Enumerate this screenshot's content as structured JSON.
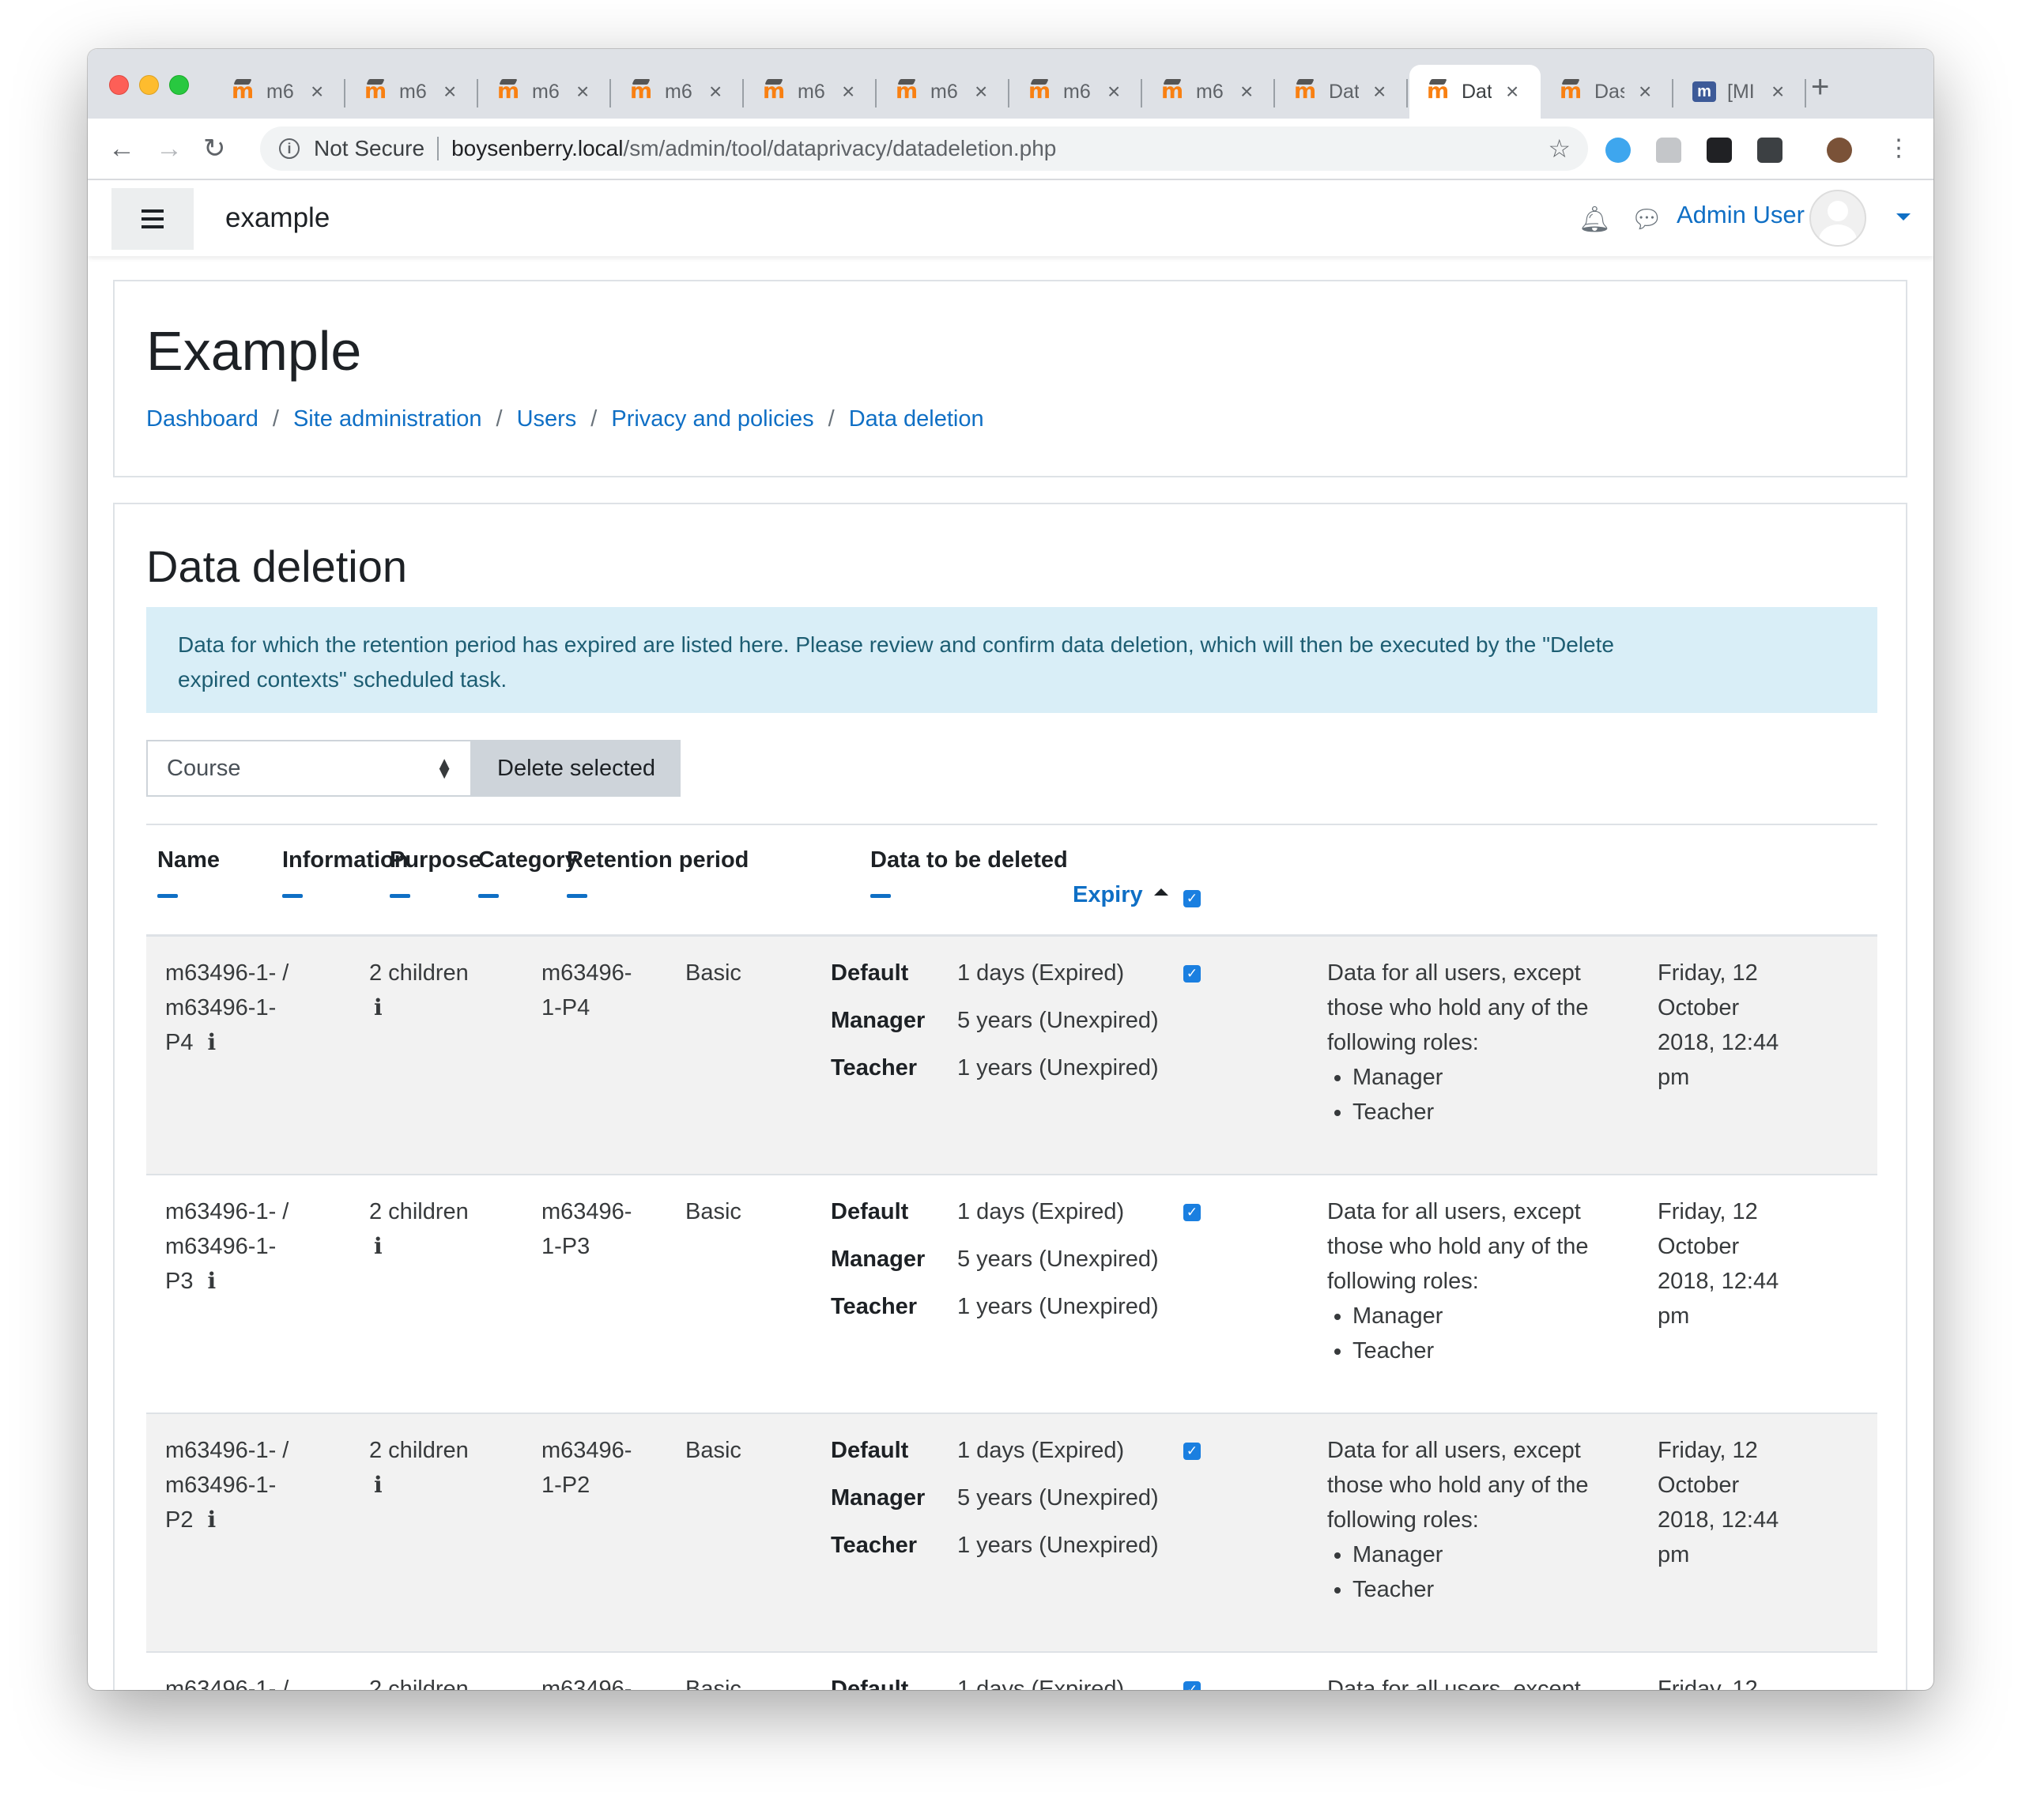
{
  "browser": {
    "tabs": [
      {
        "favicon": "moodle-icon",
        "title": "m6"
      },
      {
        "favicon": "moodle-icon",
        "title": "m6"
      },
      {
        "favicon": "moodle-icon",
        "title": "m6"
      },
      {
        "favicon": "moodle-icon",
        "title": "m6"
      },
      {
        "favicon": "moodle-icon",
        "title": "m6"
      },
      {
        "favicon": "moodle-icon",
        "title": "m6"
      },
      {
        "favicon": "moodle-icon",
        "title": "m6"
      },
      {
        "favicon": "moodle-icon",
        "title": "m6"
      },
      {
        "favicon": "moodle-icon",
        "title": "Dat"
      },
      {
        "favicon": "moodle-icon",
        "title": "Dat",
        "active": true
      },
      {
        "favicon": "moodle-icon",
        "title": "Das"
      },
      {
        "favicon": "moodle-tracker-icon",
        "title": "[MI"
      }
    ],
    "security_label": "Not Secure",
    "url_host": "boysenberry.local",
    "url_path": "/sm/admin/tool/dataprivacy/datadeletion.php"
  },
  "navbar": {
    "site_name": "example",
    "user_name": "Admin User"
  },
  "page": {
    "heading": "Example",
    "breadcrumb": [
      "Dashboard",
      "Site administration",
      "Users",
      "Privacy and policies",
      "Data deletion"
    ]
  },
  "main": {
    "title": "Data deletion",
    "alert_line1": "Data for which the retention period has expired are listed here. Please review and confirm data deletion, which will then be executed by the \"Delete",
    "alert_line2": "expired contexts\" scheduled task.",
    "filter_value": "Course",
    "delete_button": "Delete selected"
  },
  "table": {
    "headers": {
      "name": "Name",
      "information": "Information",
      "purpose": "Purpose",
      "category": "Category",
      "retention": "Retention period",
      "data_deleted": "Data to be deleted",
      "expiry": "Expiry"
    },
    "rows": [
      {
        "name_l1": "m63496-1- /",
        "name_l2": "m63496-1-",
        "name_l3": "P4",
        "info": "2 children",
        "purpose_l1": "m63496-",
        "purpose_l2": "1-P4",
        "category": "Basic",
        "retention": [
          {
            "role": "Default",
            "period": "1 days (Expired)"
          },
          {
            "role": "Manager",
            "period": "5 years (Unexpired)"
          },
          {
            "role": "Teacher",
            "period": "1 years (Unexpired)"
          }
        ],
        "del_l1": "Data for all users, except",
        "del_l2": "those who hold any of the",
        "del_l3": "following roles:",
        "del_roles": [
          "Manager",
          "Teacher"
        ],
        "exp_l1": "Friday, 12",
        "exp_l2": "October",
        "exp_l3": "2018, 12:44",
        "exp_l4": "pm",
        "checked": true
      },
      {
        "name_l1": "m63496-1- /",
        "name_l2": "m63496-1-",
        "name_l3": "P3",
        "info": "2 children",
        "purpose_l1": "m63496-",
        "purpose_l2": "1-P3",
        "category": "Basic",
        "retention": [
          {
            "role": "Default",
            "period": "1 days (Expired)"
          },
          {
            "role": "Manager",
            "period": "5 years (Unexpired)"
          },
          {
            "role": "Teacher",
            "period": "1 years (Unexpired)"
          }
        ],
        "del_l1": "Data for all users, except",
        "del_l2": "those who hold any of the",
        "del_l3": "following roles:",
        "del_roles": [
          "Manager",
          "Teacher"
        ],
        "exp_l1": "Friday, 12",
        "exp_l2": "October",
        "exp_l3": "2018, 12:44",
        "exp_l4": "pm",
        "checked": true
      },
      {
        "name_l1": "m63496-1- /",
        "name_l2": "m63496-1-",
        "name_l3": "P2",
        "info": "2 children",
        "purpose_l1": "m63496-",
        "purpose_l2": "1-P2",
        "category": "Basic",
        "retention": [
          {
            "role": "Default",
            "period": "1 days (Expired)"
          },
          {
            "role": "Manager",
            "period": "5 years (Unexpired)"
          },
          {
            "role": "Teacher",
            "period": "1 years (Unexpired)"
          }
        ],
        "del_l1": "Data for all users, except",
        "del_l2": "those who hold any of the",
        "del_l3": "following roles:",
        "del_roles": [
          "Manager",
          "Teacher"
        ],
        "exp_l1": "Friday, 12",
        "exp_l2": "October",
        "exp_l3": "2018, 12:44",
        "exp_l4": "pm",
        "checked": true
      },
      {
        "name_l1": "m63496-1- /",
        "info": "2 children",
        "purpose_l1": "m63496-",
        "category": "Basic",
        "retention": [
          {
            "role": "Default",
            "period": "1 days (Expired)"
          }
        ],
        "del_l1": "Data for all users, except",
        "exp_l1": "Friday, 12",
        "checked": true
      }
    ]
  }
}
